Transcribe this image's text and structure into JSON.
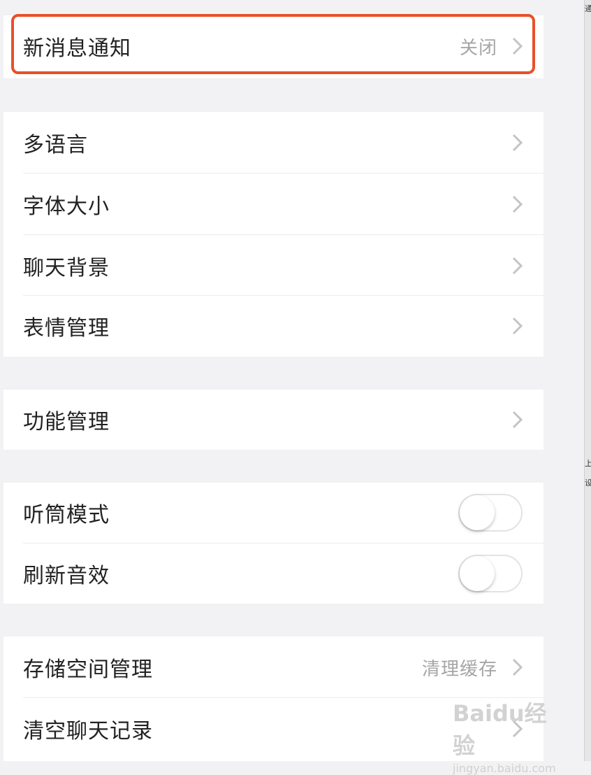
{
  "settings": {
    "group1": {
      "notifications": {
        "label": "新消息通知",
        "value": "关闭"
      }
    },
    "group2": {
      "language": {
        "label": "多语言"
      },
      "font_size": {
        "label": "字体大小"
      },
      "chat_background": {
        "label": "聊天背景"
      },
      "sticker_management": {
        "label": "表情管理"
      }
    },
    "group3": {
      "feature_management": {
        "label": "功能管理"
      }
    },
    "group4": {
      "earpiece_mode": {
        "label": "听筒模式",
        "enabled": false
      },
      "refresh_sound": {
        "label": "刷新音效",
        "enabled": false
      }
    },
    "group5": {
      "storage": {
        "label": "存储空间管理",
        "value": "清理缓存"
      },
      "clear_history": {
        "label": "清空聊天记录"
      }
    }
  },
  "highlight_color": "#e8502a",
  "watermark": {
    "logo": "Baidu经验",
    "site": "jingyan.baidu.com"
  },
  "side_strip": {
    "char1": "通",
    "char2": "上",
    "char3": "设"
  }
}
